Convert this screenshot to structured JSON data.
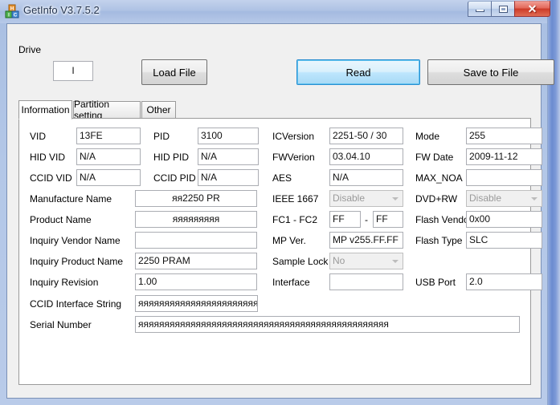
{
  "window": {
    "title": "GetInfo V3.7.5.2",
    "app_icon": "app-blocks-icon",
    "blurred_background_line1": "",
    "blurred_background_line2": "",
    "controls": {
      "minimize": "minimize-icon",
      "maximize": "maximize-icon",
      "close": "✕"
    }
  },
  "toolbar": {
    "drive_label": "Drive",
    "drive_value": "I",
    "load_file_label": "Load File",
    "read_label": "Read",
    "save_to_file_label": "Save to File"
  },
  "tabs": [
    {
      "label": "Information",
      "active": true
    },
    {
      "label": "Partition setting",
      "active": false
    },
    {
      "label": "Other",
      "active": false
    }
  ],
  "information": {
    "col1": [
      {
        "label": "VID",
        "value": "13FE"
      },
      {
        "label": "HID VID",
        "value": "N/A"
      },
      {
        "label": "CCID VID",
        "value": "N/A"
      },
      {
        "label": "Manufacture Name",
        "value": "яя2250 PR"
      },
      {
        "label": "Product Name",
        "value": "яяяяяяяяя"
      },
      {
        "label": "Inquiry Vendor Name",
        "value": ""
      },
      {
        "label": "Inquiry Product Name",
        "value": "2250 PRAM"
      },
      {
        "label": "Inquiry Revision",
        "value": "1.00"
      },
      {
        "label": "CCID Interface String",
        "value": "яяяяяяяяяяяяяяяяяяяяяяяяяя"
      },
      {
        "label": "Serial Number",
        "value": "яяяяяяяяяяяяяяяяяяяяяяяяяяяяяяяяяяяяяяяяяяяяяяяя"
      }
    ],
    "col2": [
      {
        "label": "PID",
        "value": "3100"
      },
      {
        "label": "HID PID",
        "value": "N/A"
      },
      {
        "label": "CCID PID",
        "value": "N/A"
      }
    ],
    "col3": [
      {
        "label": "ICVersion",
        "value": "2251-50 / 30"
      },
      {
        "label": "FWVerion",
        "value": "03.04.10"
      },
      {
        "label": "AES",
        "value": "N/A"
      },
      {
        "label": "IEEE 1667",
        "value": "Disable",
        "type": "combo",
        "disabled": true
      },
      {
        "label": "FC1 - FC2",
        "value": "FF",
        "value2": "FF",
        "separator": "-"
      },
      {
        "label": "MP Ver.",
        "value": "MP v255.FF.FF"
      },
      {
        "label": "Sample Lock",
        "value": "No",
        "type": "combo",
        "disabled": true
      },
      {
        "label": "Interface",
        "value": ""
      }
    ],
    "col4": [
      {
        "label": "Mode",
        "value": "255"
      },
      {
        "label": "FW Date",
        "value": "2009-11-12"
      },
      {
        "label": "MAX_NOA",
        "value": ""
      },
      {
        "label": "DVD+RW",
        "value": "Disable",
        "type": "combo",
        "disabled": true
      },
      {
        "label": "Flash Vendor",
        "value": "0x00"
      },
      {
        "label": "Flash Type",
        "value": "SLC"
      },
      {
        "label": "USB Port",
        "value": "2.0"
      }
    ]
  },
  "colors": {
    "focus_accent": "#2c8fd1",
    "window_frame": "#b3c7e7",
    "close_button": "#cc3a28"
  }
}
